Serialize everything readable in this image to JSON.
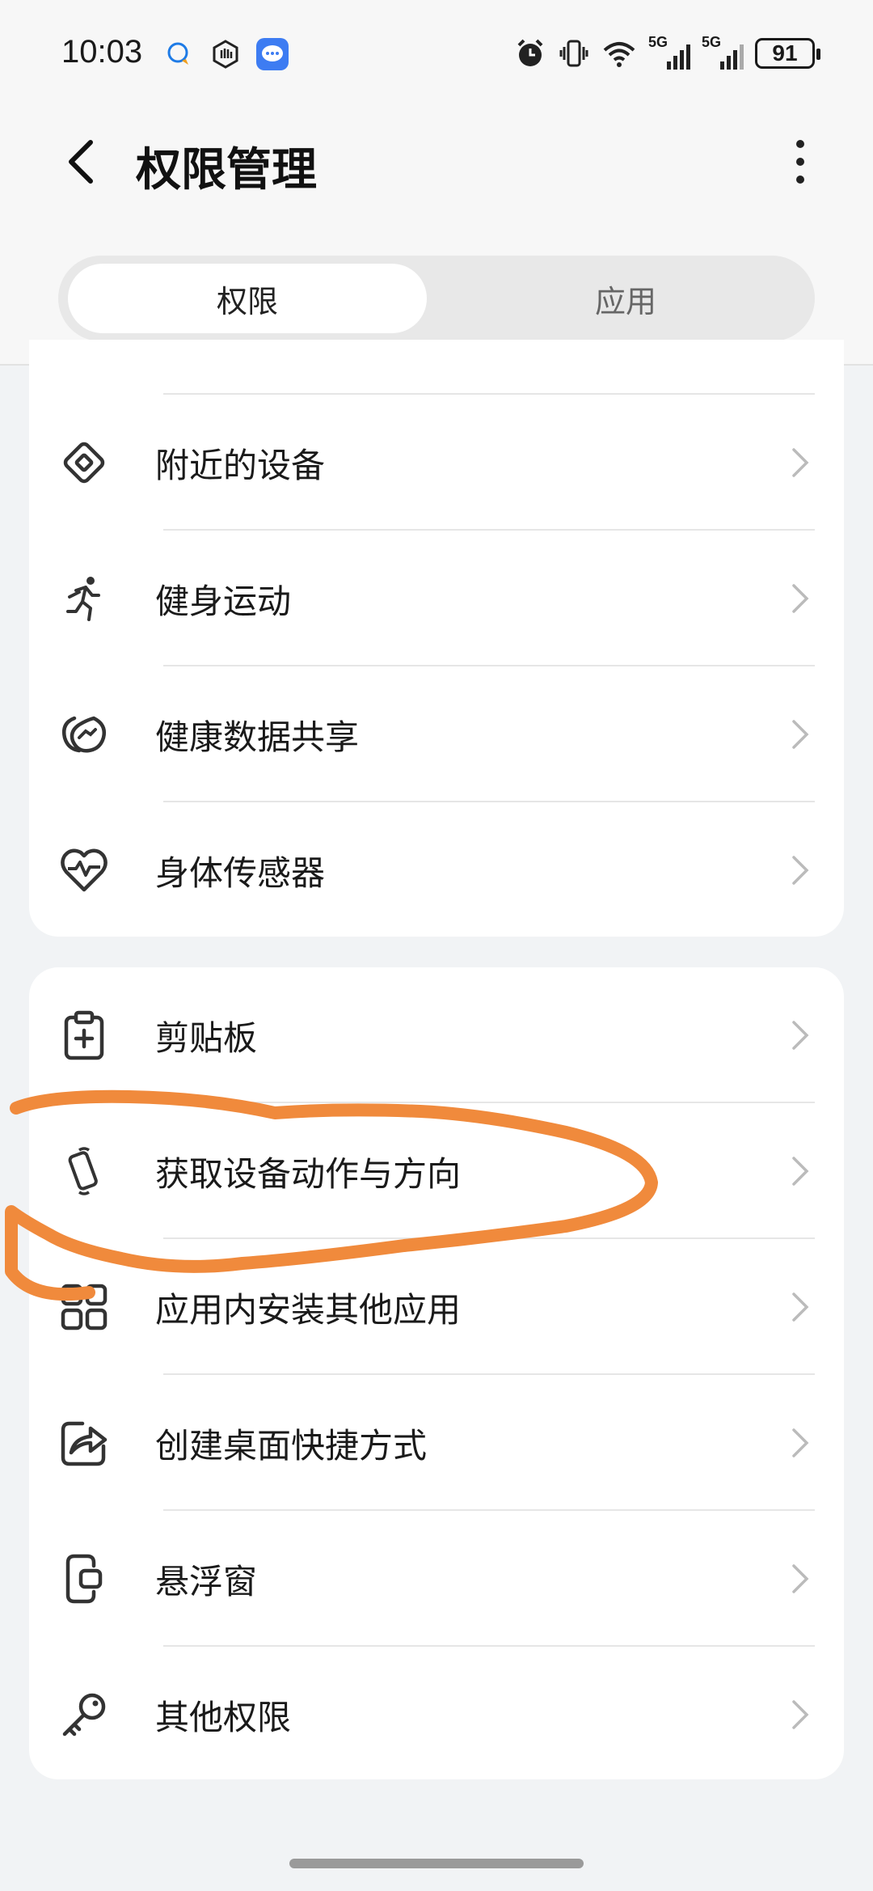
{
  "status_bar": {
    "time": "10:03",
    "left_icons": [
      "chat-bubble-icon",
      "hand-hexagon-icon",
      "message-app-icon"
    ],
    "right_icons": [
      "alarm-icon",
      "vibrate-icon",
      "wifi-icon",
      "signal-5g-icon",
      "signal-5g-icon"
    ],
    "signal_labels": [
      "5G",
      "5G"
    ],
    "battery": "91"
  },
  "header": {
    "title": "权限管理",
    "back_icon": "back-arrow-icon",
    "more_icon": "more-vertical-icon"
  },
  "tabs": [
    {
      "label": "权限",
      "active": true
    },
    {
      "label": "应用",
      "active": false
    }
  ],
  "group1": [
    {
      "label": "附近的设备",
      "icon": "nearby-diamond-icon"
    },
    {
      "label": "健身运动",
      "icon": "running-person-icon"
    },
    {
      "label": "健康数据共享",
      "icon": "health-share-icon"
    },
    {
      "label": "身体传感器",
      "icon": "heart-pulse-icon"
    }
  ],
  "group2": [
    {
      "label": "剪贴板",
      "icon": "clipboard-icon"
    },
    {
      "label": "获取设备动作与方向",
      "icon": "device-rotation-icon"
    },
    {
      "label": "应用内安装其他应用",
      "icon": "app-grid-icon"
    },
    {
      "label": "创建桌面快捷方式",
      "icon": "shortcut-share-icon"
    },
    {
      "label": "悬浮窗",
      "icon": "floating-window-icon"
    },
    {
      "label": "其他权限",
      "icon": "key-icon"
    }
  ],
  "colors": {
    "annotation_stroke": "#f08a3c",
    "background": "#f1f3f5",
    "card": "#ffffff"
  }
}
